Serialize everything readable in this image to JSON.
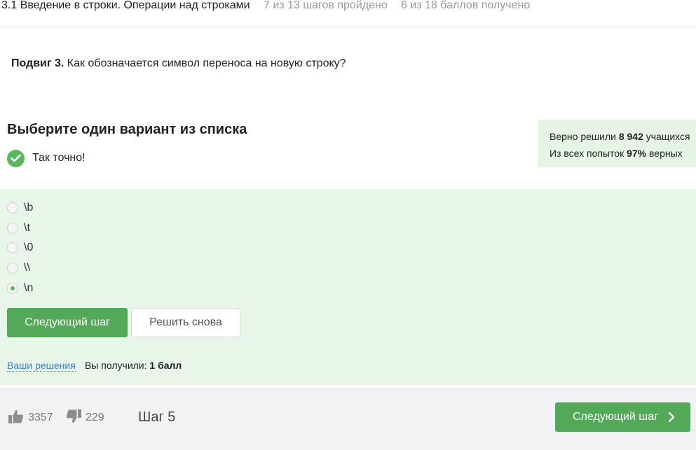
{
  "header": {
    "lesson_title": "3.1 Введение в строки. Операции над строками",
    "steps_progress": "7 из 13 шагов пройдено",
    "score_progress": "6 из 18 баллов  получено"
  },
  "question": {
    "bold_prefix": "Подвиг 3.",
    "text": " Как обозначается символ переноса на новую строку?"
  },
  "quiz": {
    "title": "Выберите один вариант из списка",
    "feedback": "Так точно!",
    "options": [
      "\\b",
      "\\t",
      "\\0",
      "\\\\",
      "\\n"
    ],
    "selected_index": 4
  },
  "stats": {
    "solved_prefix": "Верно решили ",
    "solved_count": "8 942",
    "solved_suffix": " учащихся",
    "attempts_prefix": "Из всех попыток ",
    "attempts_percent": "97%",
    "attempts_suffix": " верных"
  },
  "actions": {
    "next_step": "Следующий шаг",
    "retry": "Решить снова"
  },
  "result": {
    "solutions_link": "Ваши решения",
    "received_prefix": "Вы получили: ",
    "received_value": "1 балл"
  },
  "footer": {
    "likes": "3357",
    "dislikes": "229",
    "step_label": "Шаг 5",
    "next_button": "Следующий шаг"
  },
  "colors": {
    "accent_green": "#53a957",
    "panel_green": "#e8f5e9",
    "link_blue": "#3b7fcf"
  }
}
